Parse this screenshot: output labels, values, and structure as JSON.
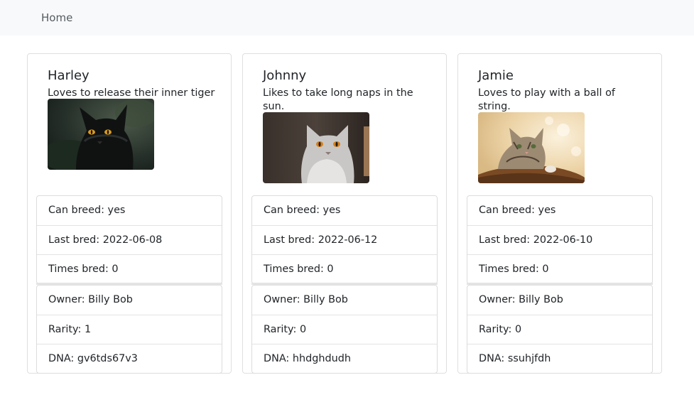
{
  "nav": {
    "home_label": "Home"
  },
  "cats": [
    {
      "name": "Harley",
      "description": "Loves to release their inner tiger",
      "image_icon": "black-cat-photo",
      "can_breed": "Can breed: yes",
      "last_bred": "Last bred: 2022-06-08",
      "times_bred": "Times bred: 0",
      "owner": "Owner: Billy Bob",
      "rarity": "Rarity: 1",
      "dna": "DNA: gv6tds67v3"
    },
    {
      "name": "Johnny",
      "description": "Likes to take long naps in the sun.",
      "image_icon": "grey-cat-photo",
      "can_breed": "Can breed: yes",
      "last_bred": "Last bred: 2022-06-12",
      "times_bred": "Times bred: 0",
      "owner": "Owner: Billy Bob",
      "rarity": "Rarity: 0",
      "dna": "DNA: hhdghdudh"
    },
    {
      "name": "Jamie",
      "description": "Loves to play with a ball of string.",
      "image_icon": "tabby-kitten-photo",
      "can_breed": "Can breed: yes",
      "last_bred": "Last bred: 2022-06-10",
      "times_bred": "Times bred: 0",
      "owner": "Owner: Billy Bob",
      "rarity": "Rarity: 0",
      "dna": "DNA: ssuhjfdh"
    }
  ]
}
